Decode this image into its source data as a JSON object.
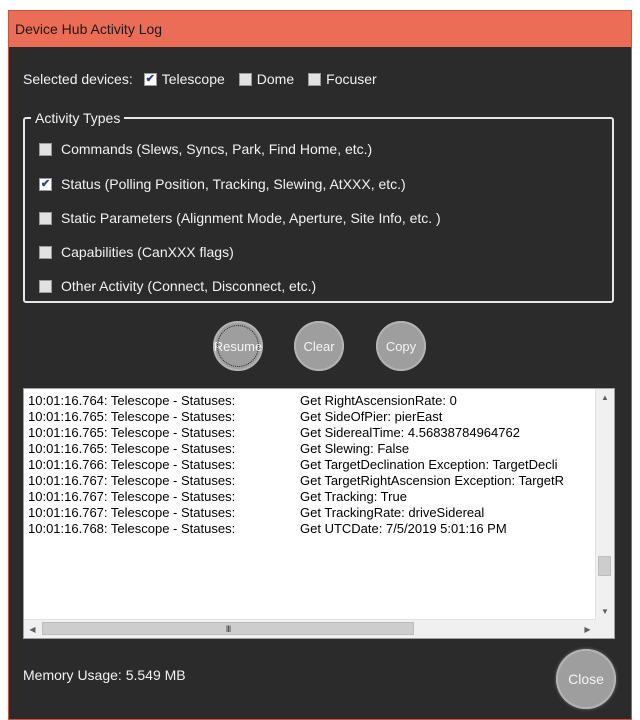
{
  "window": {
    "title": "Device Hub Activity Log"
  },
  "devices": {
    "label": "Selected devices:",
    "items": [
      {
        "label": "Telescope",
        "checked": true
      },
      {
        "label": "Dome",
        "checked": false
      },
      {
        "label": "Focuser",
        "checked": false
      }
    ]
  },
  "activity_types": {
    "title": "Activity Types",
    "items": [
      {
        "label": "Commands (Slews, Syncs, Park, Find Home, etc.)",
        "checked": false
      },
      {
        "label": "Status (Polling Position, Tracking, Slewing, AtXXX, etc.)",
        "checked": true
      },
      {
        "label": "Static Parameters (Alignment Mode, Aperture, Site Info, etc. )",
        "checked": false
      },
      {
        "label": "Capabilities (CanXXX flags)",
        "checked": false
      },
      {
        "label": "Other Activity (Connect, Disconnect, etc.)",
        "checked": false
      }
    ]
  },
  "buttons": {
    "resume": "Resume",
    "clear": "Clear",
    "copy": "Copy",
    "close": "Close"
  },
  "log": {
    "lines": [
      {
        "source": "10:01:16.764: Telescope - Statuses:",
        "message": "Get RightAscensionRate: 0"
      },
      {
        "source": "10:01:16.765: Telescope - Statuses:",
        "message": "Get SideOfPier: pierEast"
      },
      {
        "source": "10:01:16.765: Telescope - Statuses:",
        "message": "Get SiderealTime: 4.56838784964762"
      },
      {
        "source": "10:01:16.765: Telescope - Statuses:",
        "message": "Get Slewing: False"
      },
      {
        "source": "10:01:16.766: Telescope - Statuses:",
        "message": "Get TargetDeclination Exception: TargetDecli"
      },
      {
        "source": "10:01:16.767: Telescope - Statuses:",
        "message": "Get TargetRightAscension Exception: TargetR"
      },
      {
        "source": "10:01:16.767: Telescope - Statuses:",
        "message": "Get Tracking: True"
      },
      {
        "source": "10:01:16.767: Telescope - Statuses:",
        "message": "Get TrackingRate: driveSidereal"
      },
      {
        "source": "10:01:16.768: Telescope - Statuses:",
        "message": "Get UTCDate: 7/5/2019 5:01:16 PM"
      }
    ],
    "hscroll_grip": "III"
  },
  "memory": {
    "text": "Memory Usage: 5.549 MB"
  },
  "colors": {
    "titlebar": "#ec6d56",
    "background": "#2b2b2b",
    "button": "#9e9e9e",
    "check": "#2a3b9a"
  }
}
